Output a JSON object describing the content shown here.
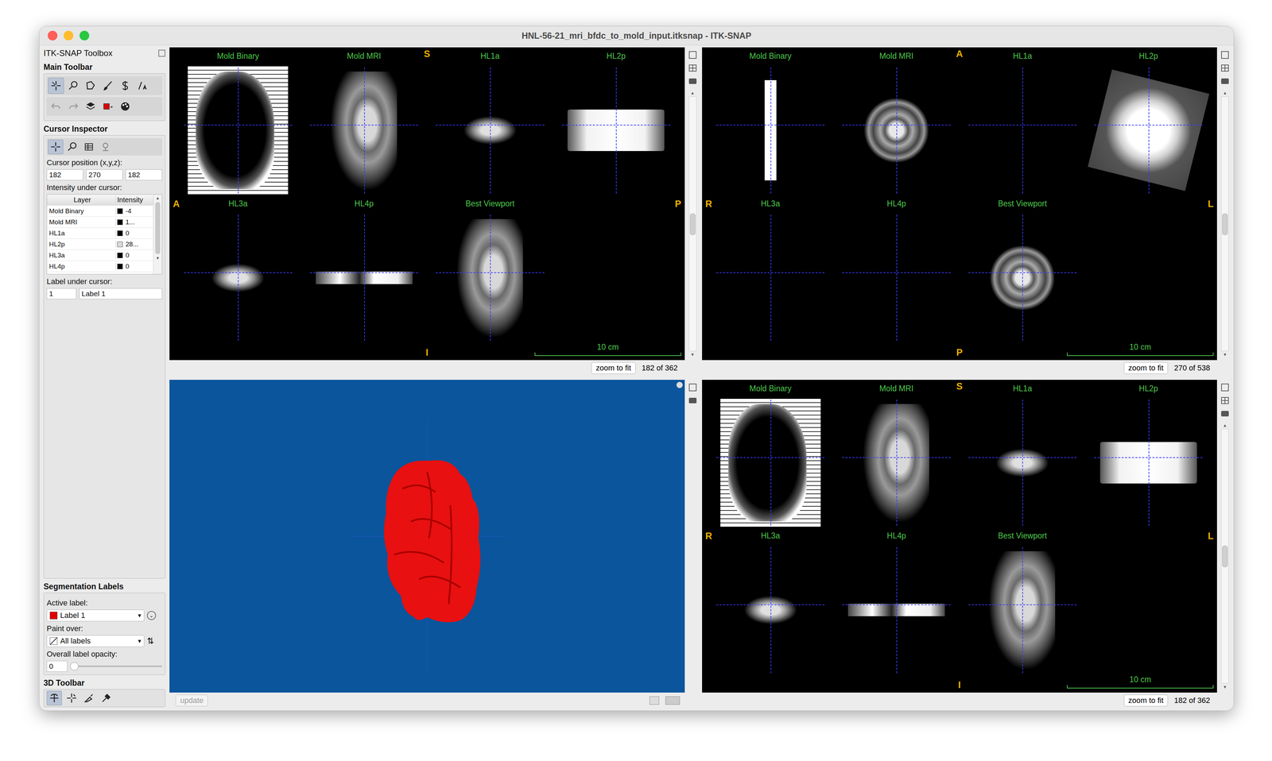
{
  "window": {
    "title": "HNL-56-21_mri_bfdc_to_mold_input.itksnap - ITK-SNAP"
  },
  "toolbox": {
    "title": "ITK-SNAP Toolbox",
    "main_toolbar": {
      "heading": "Main Toolbar",
      "tools": [
        {
          "kind": "crosshair",
          "selected": true
        },
        {
          "kind": "zoom",
          "selected": false
        },
        {
          "kind": "polygon",
          "selected": false
        },
        {
          "kind": "paintbrush",
          "selected": false
        },
        {
          "kind": "snake",
          "selected": false
        },
        {
          "kind": "annotation",
          "selected": false
        }
      ],
      "actions": [
        {
          "kind": "undo",
          "disabled": true
        },
        {
          "kind": "redo",
          "disabled": true
        },
        {
          "kind": "layers",
          "disabled": false
        },
        {
          "kind": "label-color",
          "disabled": false
        },
        {
          "kind": "palette",
          "disabled": false
        }
      ]
    },
    "cursor_inspector": {
      "heading": "Cursor Inspector",
      "tabs": [
        {
          "kind": "crosshair",
          "selected": true
        },
        {
          "kind": "zoom",
          "selected": false
        },
        {
          "kind": "table",
          "selected": false
        },
        {
          "kind": "sync",
          "selected": false
        }
      ],
      "position_label": "Cursor position (x,y,z):",
      "position": [
        "182",
        "270",
        "182"
      ],
      "intensity_label": "Intensity under cursor:",
      "columns": [
        "Layer",
        "Intensity"
      ],
      "rows": [
        {
          "layer": "Mold Binary",
          "value": "-4",
          "color": "#000000"
        },
        {
          "layer": "Mold MRI",
          "value": "1...",
          "color": "#000000"
        },
        {
          "layer": "HL1a",
          "value": "0",
          "color": "#000000"
        },
        {
          "layer": "HL2p",
          "value": "28...",
          "color": "#d8d8d8"
        },
        {
          "layer": "HL3a",
          "value": "0",
          "color": "#000000"
        },
        {
          "layer": "HL4p",
          "value": "0",
          "color": "#000000"
        }
      ],
      "label_label": "Label under cursor:",
      "label_id": "1",
      "label_name": "Label 1"
    },
    "segmentation": {
      "heading": "Segmentation Labels",
      "active_label_caption": "Active label:",
      "active_label": "Label 1",
      "active_color": "#e00000",
      "paint_over_caption": "Paint over:",
      "paint_over": "All labels",
      "opacity_caption": "Overall label opacity:",
      "opacity_value": "0",
      "opacity_level": 0
    },
    "toolbar3d": {
      "heading": "3D Toolbar",
      "tools": [
        {
          "kind": "rotate",
          "selected": true
        },
        {
          "kind": "crosshair3d",
          "selected": false
        },
        {
          "kind": "scalpel",
          "selected": false
        },
        {
          "kind": "spray",
          "selected": false
        }
      ]
    }
  },
  "views": [
    {
      "kind": "slice",
      "top": "S",
      "left": "A",
      "right": "P",
      "bottom": "I",
      "scale": "10 cm",
      "zoom_button": "zoom to fit",
      "slice": "182 of 362",
      "slider_level": 0.5,
      "tiles": [
        {
          "label": "Mold Binary",
          "image": "binary"
        },
        {
          "label": "Mold MRI",
          "image": "scan"
        },
        {
          "label": "HL1a",
          "image": "scan-small"
        },
        {
          "label": "HL2p",
          "image": "bright"
        },
        {
          "label": "HL3a",
          "image": "scan-small"
        },
        {
          "label": "HL4p",
          "image": "strip"
        },
        {
          "label": "Best Viewport",
          "image": "scan"
        }
      ]
    },
    {
      "kind": "slice",
      "top": "A",
      "left": "R",
      "right": "L",
      "bottom": "P",
      "scale": "10 cm",
      "zoom_button": "zoom to fit",
      "slice": "270 of 538",
      "slider_level": 0.5,
      "tiles": [
        {
          "label": "Mold Binary",
          "image": "bar"
        },
        {
          "label": "Mold MRI",
          "image": "scan-round"
        },
        {
          "label": "HL1a",
          "image": "none"
        },
        {
          "label": "HL2p",
          "image": "bright-square"
        },
        {
          "label": "HL3a",
          "image": "none"
        },
        {
          "label": "HL4p",
          "image": "none"
        },
        {
          "label": "Best Viewport",
          "image": "scan-round"
        }
      ]
    },
    {
      "kind": "3d",
      "update_button": "update",
      "update_disabled": true
    },
    {
      "kind": "slice",
      "top": "S",
      "left": "R",
      "right": "L",
      "bottom": "I",
      "scale": "10 cm",
      "zoom_button": "zoom to fit",
      "slice": "182 of 362",
      "slider_level": 0.5,
      "tiles": [
        {
          "label": "Mold Binary",
          "image": "binary"
        },
        {
          "label": "Mold MRI",
          "image": "scan"
        },
        {
          "label": "HL1a",
          "image": "scan-small"
        },
        {
          "label": "HL2p",
          "image": "bright"
        },
        {
          "label": "HL3a",
          "image": "scan-small"
        },
        {
          "label": "HL4p",
          "image": "strip"
        },
        {
          "label": "Best Viewport",
          "image": "scan"
        }
      ]
    }
  ]
}
